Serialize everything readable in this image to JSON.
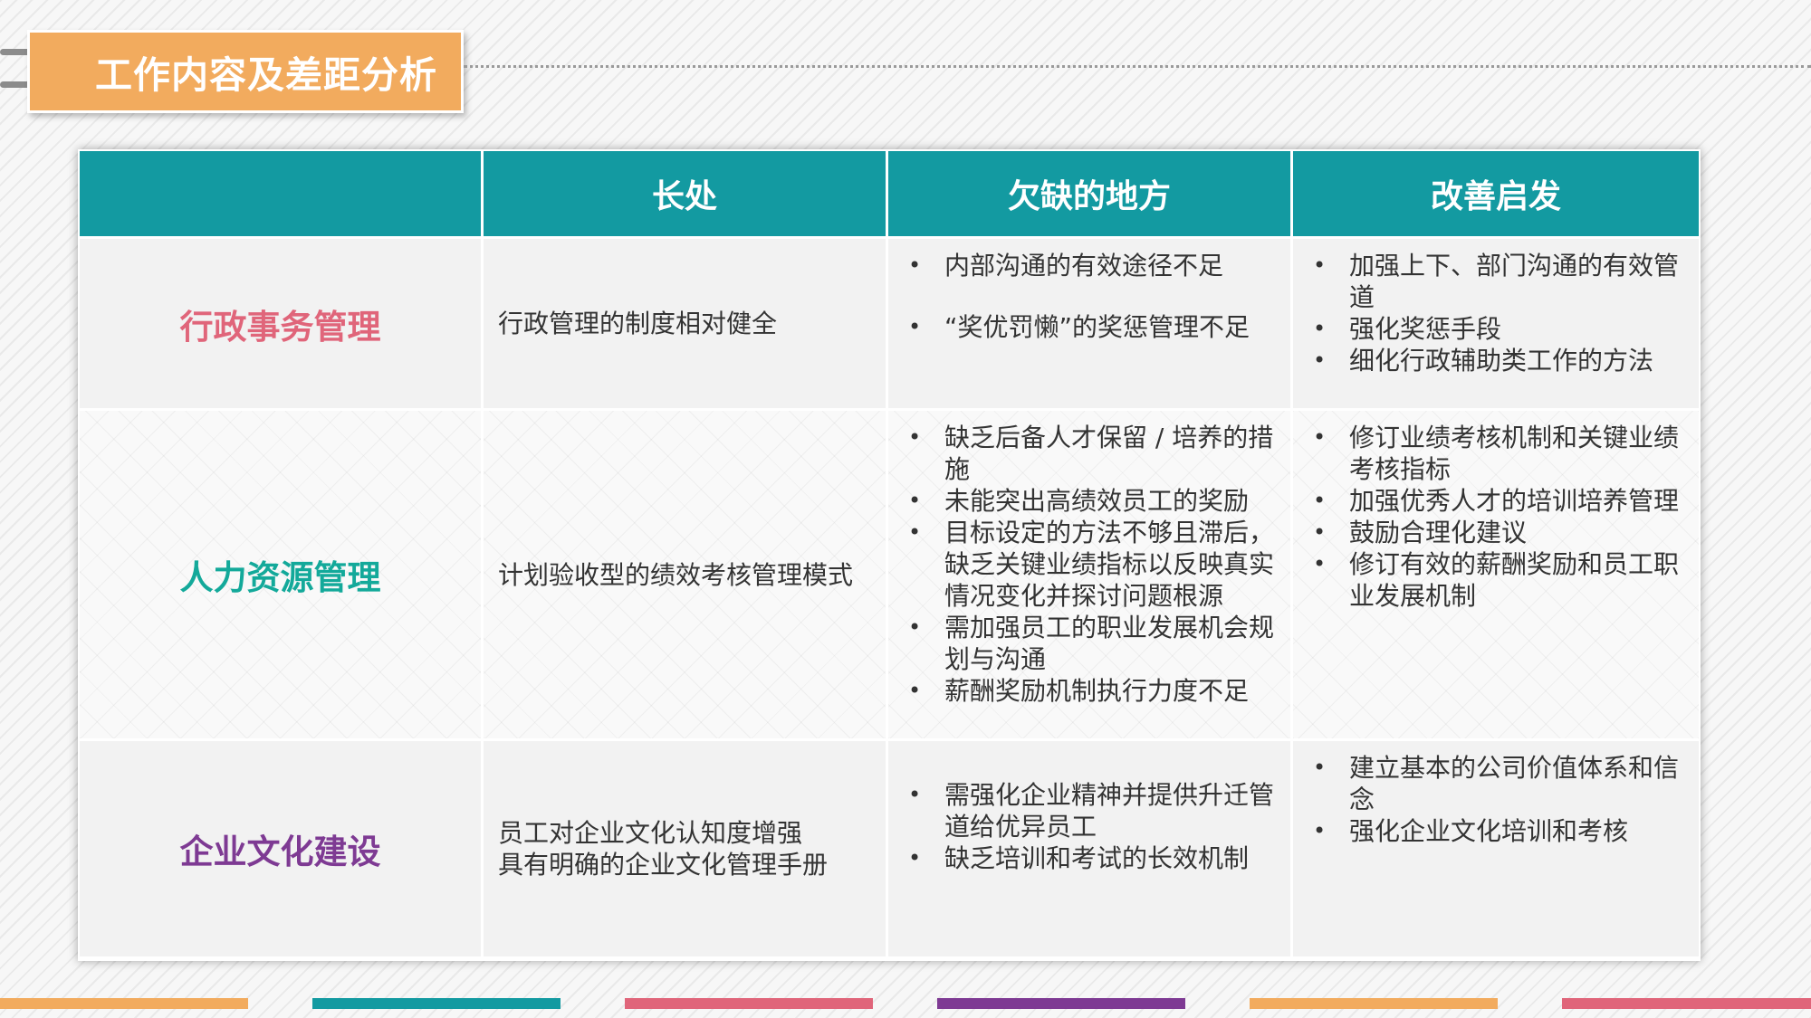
{
  "title": "工作内容及差距分析",
  "headers": [
    "",
    "长处",
    "欠缺的地方",
    "改善启发"
  ],
  "rows": [
    {
      "category": "行政事务管理",
      "strength": [
        "行政管理的制度相对健全"
      ],
      "gaps": [
        "内部沟通的有效途径不足",
        "“奖优罚懒”的奖惩管理不足"
      ],
      "improvements": [
        "加强上下、部门沟通的有效管道",
        "强化奖惩手段",
        "细化行政辅助类工作的方法"
      ]
    },
    {
      "category": "人力资源管理",
      "strength": [
        "计划验收型的绩效考核管理模式"
      ],
      "gaps": [
        "缺乏后备人才保留 / 培养的措施",
        "未能突出高绩效员工的奖励",
        "目标设定的方法不够且滞后，缺乏关键业绩指标以反映真实情况变化并探讨问题根源",
        "需加强员工的职业发展机会规划与沟通",
        "薪酬奖励机制执行力度不足"
      ],
      "improvements": [
        "修订业绩考核机制和关键业绩考核指标",
        "加强优秀人才的培训培养管理",
        "鼓励合理化建议",
        "修订有效的薪酬奖励和员工职业发展机制"
      ]
    },
    {
      "category": "企业文化建设",
      "strength": [
        "员工对企业文化认知度增强",
        "具有明确的企业文化管理手册"
      ],
      "gaps": [
        "需强化企业精神并提供升迁管道给优异员工",
        "缺乏培训和考试的长效机制"
      ],
      "improvements": [
        "建立基本的公司价值体系和信念",
        "强化企业文化培训和考核"
      ]
    }
  ],
  "colors": {
    "header_bg": "#139aa1",
    "title_tab": "#f2ab5e",
    "category_1": "#e0657a",
    "category_2": "#13a99a",
    "category_3": "#7e3a93",
    "bottom_bars": [
      "#f2ab5e",
      "#139aa1",
      "#e0657a",
      "#7e3a93",
      "#f2ab5e",
      "#e0657a"
    ]
  },
  "icons": {
    "title_tab": "binder-ring-icon"
  }
}
